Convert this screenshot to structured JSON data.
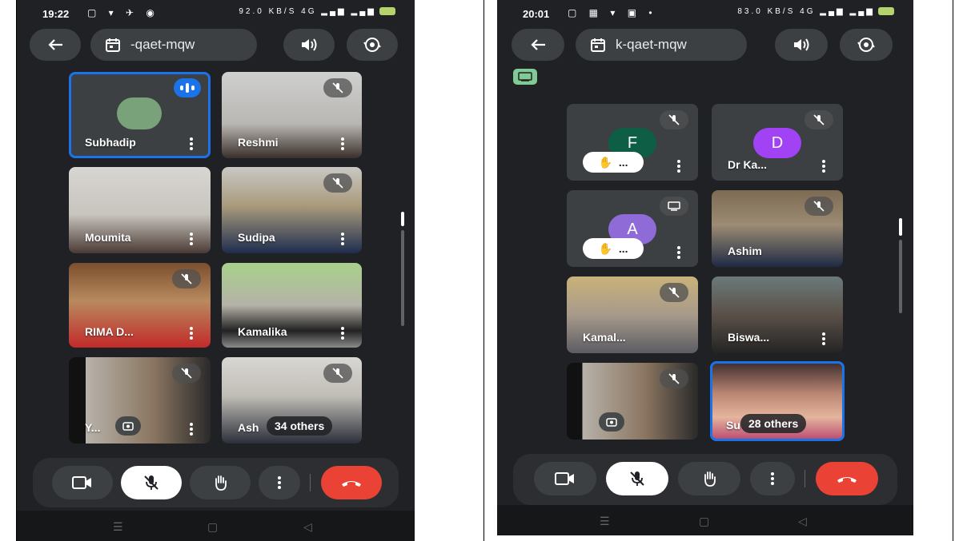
{
  "left_phone": {
    "status": {
      "time": "19:22",
      "net_speed": "92.0 KB/S",
      "signal": "4G",
      "battery": "74"
    },
    "meeting_code": "-qaet-mqw",
    "tiles": [
      {
        "name": "Subhadip",
        "state": "speaking"
      },
      {
        "name": "Reshmi",
        "state": "muted"
      },
      {
        "name": "Moumita",
        "state": "unmuted"
      },
      {
        "name": "Sudipa",
        "state": "muted"
      },
      {
        "name": "RIMA D...",
        "state": "muted"
      },
      {
        "name": "Kamalika",
        "state": "unmuted"
      },
      {
        "name": "Y...",
        "state": "muted"
      },
      {
        "name": "Ash",
        "state": "muted",
        "others": "34 others"
      }
    ]
  },
  "right_phone": {
    "status": {
      "time": "20:01",
      "net_speed": "83.0 KB/S",
      "signal": "4G",
      "battery": "81"
    },
    "meeting_code": "k-qaet-mqw",
    "tiles": [
      {
        "name": "",
        "initial": "F",
        "avatar_color": "#0d5e44",
        "state": "muted",
        "hand": "..."
      },
      {
        "name": "Dr Ka...",
        "initial": "D",
        "avatar_color": "#a142f4",
        "state": "muted"
      },
      {
        "name": "",
        "initial": "A",
        "avatar_color": "#8e6bd6",
        "state": "presenting",
        "hand": "..."
      },
      {
        "name": "Ashim",
        "state": "muted"
      },
      {
        "name": "Kamal...",
        "state": "muted"
      },
      {
        "name": "Biswa...",
        "state": "unmuted"
      },
      {
        "name": "",
        "state": "muted"
      },
      {
        "name": "Su",
        "state": "active",
        "others": "28 others"
      }
    ]
  },
  "colors": {
    "accent": "#1a73e8",
    "end_call": "#ea4335",
    "tile_bg": "#3c4043",
    "app_bg": "#202124"
  }
}
